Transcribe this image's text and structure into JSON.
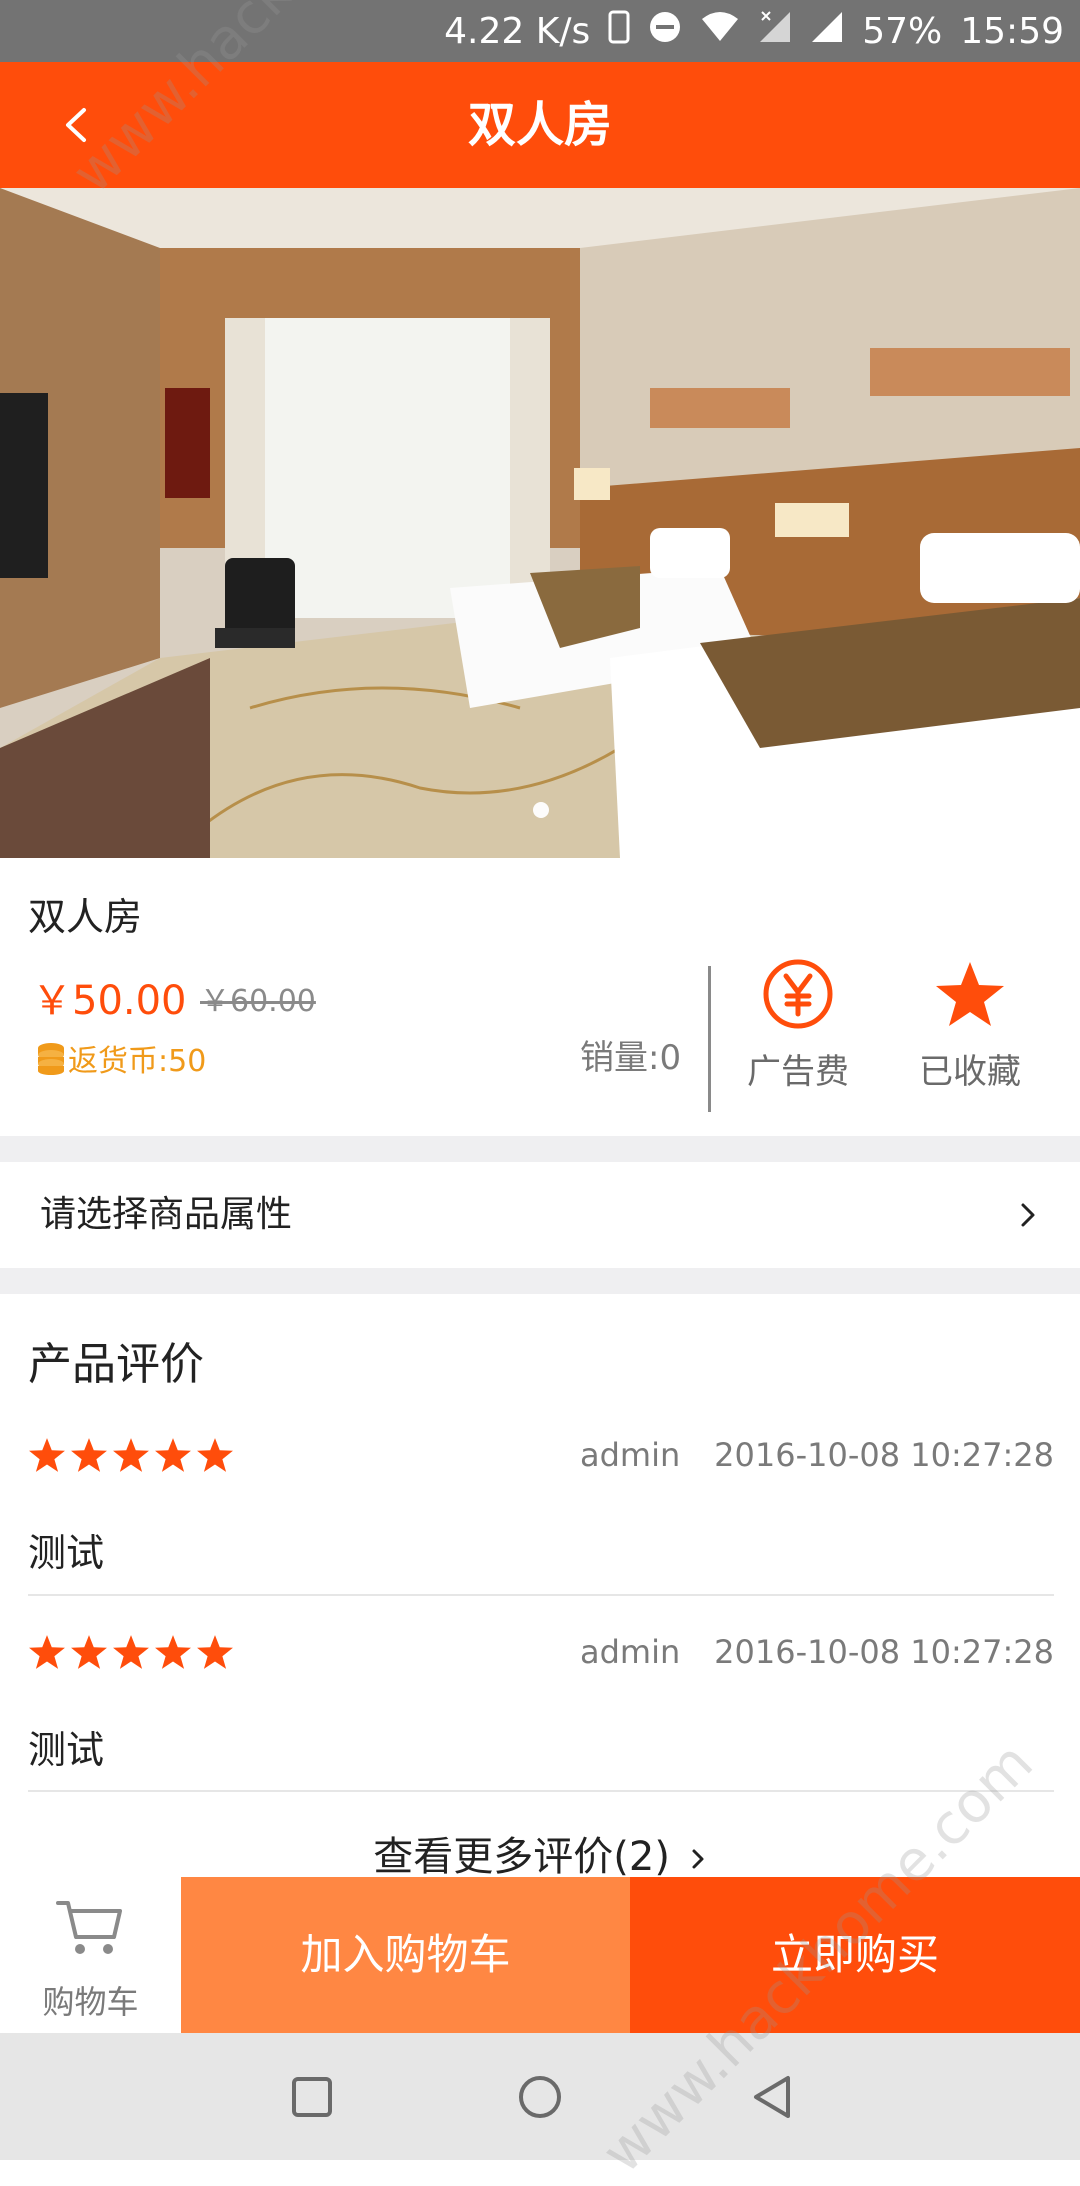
{
  "status_bar": {
    "speed": "4.22 K/s",
    "battery": "57%",
    "time": "15:59"
  },
  "header": {
    "title": "双人房"
  },
  "product": {
    "name": "双人房",
    "price": "￥50.00",
    "original_price": "￥60.00",
    "coin_reward": "返货币:50",
    "sales": "销量:0",
    "ad_fee_label": "广告费",
    "favorite_label": "已收藏"
  },
  "attributes": {
    "label": "请选择商品属性"
  },
  "reviews": {
    "title": "产品评价",
    "items": [
      {
        "rating": 5,
        "user": "admin",
        "date": "2016-10-08 10:27:28",
        "text": "测试"
      },
      {
        "rating": 5,
        "user": "admin",
        "date": "2016-10-08 10:27:28",
        "text": "测试"
      }
    ],
    "more_label": "查看更多评价(2)"
  },
  "bottom_bar": {
    "cart_label": "购物车",
    "add_to_cart_label": "加入购物车",
    "buy_now_label": "立即购买"
  },
  "watermark": "www.hackhome.com",
  "colors": {
    "accent": "#ff4d0b",
    "accent_light": "#ff8743",
    "coin": "#f09a1a"
  },
  "icons": [
    "back-arrow-icon",
    "yuan-icon",
    "star-icon",
    "cart-icon",
    "coin-icon",
    "chevron-right-icon"
  ]
}
